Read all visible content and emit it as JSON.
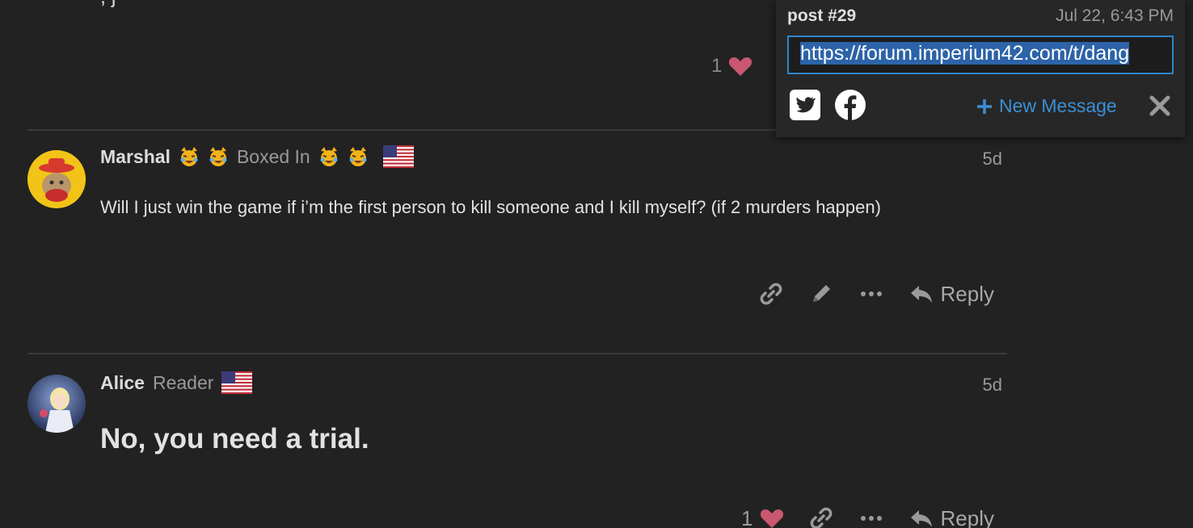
{
  "top_post": {
    "text_remnant": "...y, j...",
    "like_count": "1"
  },
  "share_popup": {
    "title": "post #29",
    "date": "Jul 22, 6:43 PM",
    "url": "https://forum.imperium42.com/t/dang",
    "new_message_label": "New Message",
    "icons": [
      "twitter-icon",
      "facebook-icon",
      "plus-icon",
      "close-icon"
    ]
  },
  "posts": [
    {
      "username": "Marshal",
      "user_title": "Boxed In",
      "date": "5d",
      "body": "Will I just win the game if i’m the first person to kill someone and I kill myself? (if 2 murders happen)",
      "reply_label": "Reply"
    },
    {
      "username": "Alice",
      "user_title": "Reader",
      "date": "5d",
      "body": "No, you need a trial.",
      "like_count": "1",
      "reply_label": "Reply"
    }
  ],
  "colors": {
    "background": "#222222",
    "accent": "#3a8fd4",
    "heart": "#c9576f"
  }
}
